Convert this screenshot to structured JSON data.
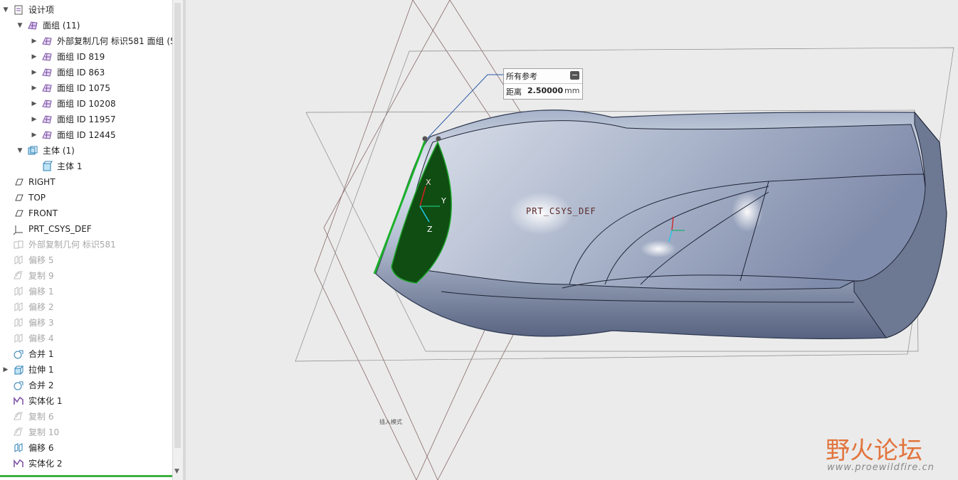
{
  "tree": {
    "items": [
      {
        "label": "设计项",
        "icon": "design-items-icon",
        "expanded": true,
        "dim": false
      },
      {
        "label": "面组 (11)",
        "icon": "quilt-group-icon",
        "expanded": true,
        "dim": false
      },
      {
        "label": "外部复制几何 标识581 面组 (5",
        "icon": "quilt-icon",
        "expanded": false,
        "dim": false
      },
      {
        "label": "面组 ID 819",
        "icon": "quilt-icon",
        "expanded": false,
        "dim": false
      },
      {
        "label": "面组 ID 863",
        "icon": "quilt-icon",
        "expanded": false,
        "dim": false
      },
      {
        "label": "面组 ID 1075",
        "icon": "quilt-icon",
        "expanded": false,
        "dim": false
      },
      {
        "label": "面组 ID 10208",
        "icon": "quilt-icon",
        "expanded": false,
        "dim": false
      },
      {
        "label": "面组 ID 11957",
        "icon": "quilt-icon",
        "expanded": false,
        "dim": false
      },
      {
        "label": "面组 ID 12445",
        "icon": "quilt-icon",
        "expanded": false,
        "dim": false
      },
      {
        "label": "主体 (1)",
        "icon": "body-group-icon",
        "expanded": true,
        "dim": false
      },
      {
        "label": "主体 1",
        "icon": "body-icon",
        "dim": false
      },
      {
        "label": "RIGHT",
        "icon": "datum-plane-icon",
        "dim": false
      },
      {
        "label": "TOP",
        "icon": "datum-plane-icon",
        "dim": false
      },
      {
        "label": "FRONT",
        "icon": "datum-plane-icon",
        "dim": false
      },
      {
        "label": "PRT_CSYS_DEF",
        "icon": "csys-icon",
        "dim": false
      },
      {
        "label": "外部复制几何 标识581",
        "icon": "copy-geom-icon",
        "dim": true
      },
      {
        "label": "偏移 5",
        "icon": "offset-icon",
        "dim": true
      },
      {
        "label": "复制 9",
        "icon": "copy-icon",
        "dim": true
      },
      {
        "label": "偏移 1",
        "icon": "offset-icon",
        "dim": true
      },
      {
        "label": "偏移 2",
        "icon": "offset-icon",
        "dim": true
      },
      {
        "label": "偏移 3",
        "icon": "offset-icon",
        "dim": true
      },
      {
        "label": "偏移 4",
        "icon": "offset-icon",
        "dim": true
      },
      {
        "label": "合并 1",
        "icon": "merge-icon",
        "dim": false
      },
      {
        "label": "拉伸 1",
        "icon": "extrude-icon",
        "expanded": false,
        "dim": false
      },
      {
        "label": "合并 2",
        "icon": "merge-icon",
        "dim": false
      },
      {
        "label": "实体化 1",
        "icon": "solidify-icon",
        "dim": false
      },
      {
        "label": "复制 6",
        "icon": "copy-icon",
        "dim": true
      },
      {
        "label": "复制 10",
        "icon": "copy-icon",
        "dim": true
      },
      {
        "label": "偏移 6",
        "icon": "offset-icon",
        "dim": false
      },
      {
        "label": "实体化 2",
        "icon": "solidify-icon",
        "dim": false
      }
    ]
  },
  "tooltip": {
    "title": "所有参考",
    "distance_label": "距离",
    "distance_value": "2.50000",
    "unit": "mm",
    "collapse_icon": "minus-icon"
  },
  "viewport": {
    "csys_label": "PRT_CSYS_DEF",
    "axis_x": "X",
    "axis_y": "Y",
    "axis_z": "Z",
    "small_text": "插入模式"
  },
  "watermark": {
    "brand": "野火论坛",
    "url": "www.proewildfire.cn"
  },
  "colors": {
    "selection_green": "#2a6b1a",
    "highlight_red": "#e8221b",
    "model_blue": "#8a97b4",
    "datum_plane": "#8a6a6a"
  }
}
